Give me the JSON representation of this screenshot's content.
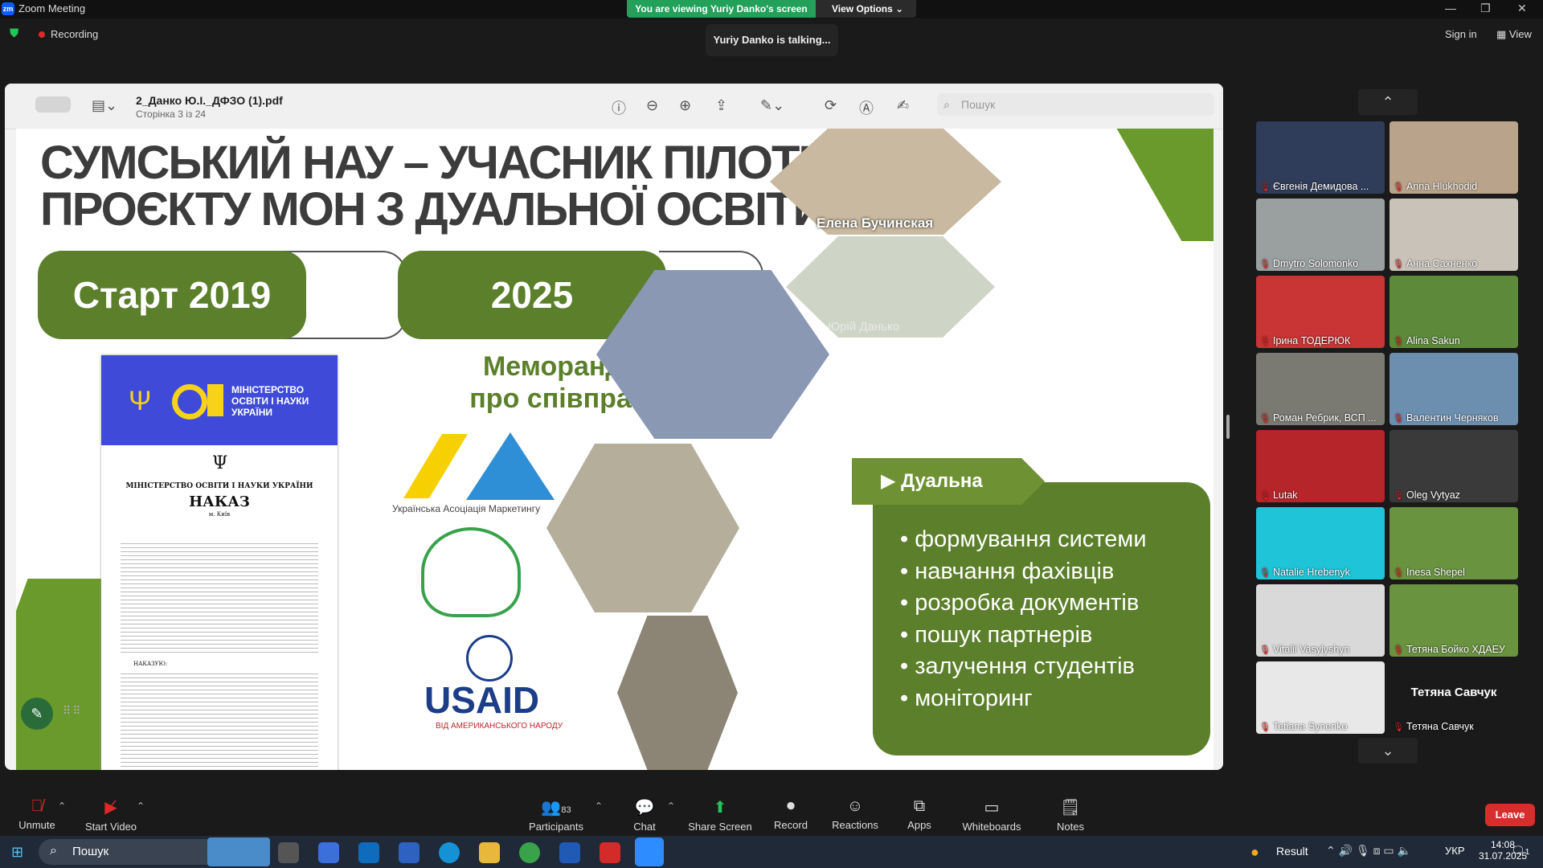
{
  "window": {
    "title": "Zoom Meeting",
    "minimize": "—",
    "maximize": "❐",
    "close": "✕"
  },
  "banner": {
    "viewing": "You are viewing Yuriy Danko's screen",
    "view_options": "View Options"
  },
  "status": {
    "recording": "Recording",
    "talking": "Yuriy Danko is talking...",
    "sign_in": "Sign in",
    "view": "View"
  },
  "pdf": {
    "filename": "2_Данко Ю.І._ДФЗО (1).pdf",
    "page_info": "Сторінка 3 із 24",
    "search_placeholder": "Пошук"
  },
  "slide": {
    "title_line1": "СУМСЬКИЙ НАУ – УЧАСНИК ПІЛОТНОГО",
    "title_line2": "ПРОЄКТУ МОН З ДУАЛЬНОЇ ОСВІТИ",
    "start": "Старт 2019",
    "year": "2025",
    "memo_line1": "Меморандум",
    "memo_line2": "про співпрацю",
    "uam": "Українська Асоціація Маркетингу",
    "usaid": "USAID",
    "usaid_sub": "ВІД АМЕРИКАНСЬКОГО НАРОДУ",
    "ministry_line1": "МІНІСТЕРСТВО",
    "ministry_line2": "ОСВІТИ І НАУКИ",
    "ministry_line3": "УКРАЇНИ",
    "doc_ministry": "МІНІСТЕРСТВО ОСВІТИ І НАУКИ УКРАЇНИ",
    "doc_title": "НАКАЗ",
    "doc_city": "м. Київ",
    "doc_order": "НАКАЗУЮ:",
    "embedded_name1": "Елена Бучинская",
    "embedded_name2": "Юрій Данько",
    "dual_heading": "Дуальна освіта",
    "bullets": [
      "формування системи",
      "навчання фахівців",
      "розробка документів",
      "пошук партнерів",
      "залучення студентів",
      "моніторинг"
    ]
  },
  "participants": [
    {
      "name": "Євгенія Демидова ...",
      "color": "#2f3d5a"
    },
    {
      "name": "Anna Hlukhodid",
      "color": "#b9a38a"
    },
    {
      "name": "Dmytro Solomonko",
      "color": "#9aa0a0"
    },
    {
      "name": "Анна Сахненко",
      "color": "#c9c2b8"
    },
    {
      "name": "Ірина ТОДЕРЮК",
      "color": "#c93434"
    },
    {
      "name": "Alina Sakun",
      "color": "#5d8a3a"
    },
    {
      "name": "Роман Ребрик, ВСП ...",
      "color": "#7a7a72"
    },
    {
      "name": "Валентин Черняков",
      "color": "#6c8fb0"
    },
    {
      "name": "Lutak",
      "color": "#b6252a"
    },
    {
      "name": "Oleg Vytyaz",
      "color": "#3a3a3a"
    },
    {
      "name": "Natalie Hrebenyk",
      "color": "#1fc4d8"
    },
    {
      "name": "Inesa Shepel",
      "color": "#6a9340"
    },
    {
      "name": "Vitalii Vasylyshyn",
      "color": "#d9d9d9"
    },
    {
      "name": "Тетяна Бойко ХДАЕУ",
      "color": "#6a9340"
    },
    {
      "name": "Tetiana Synenko",
      "color": "#e8e8e8"
    },
    {
      "name": "Тетяна Савчук",
      "color": "#1a1a1a",
      "label": "Тетяна Савчук"
    }
  ],
  "toolbar": {
    "unmute": "Unmute",
    "start_video": "Start Video",
    "participants": "Participants",
    "participants_count": "83",
    "chat": "Chat",
    "share": "Share Screen",
    "record": "Record",
    "reactions": "Reactions",
    "apps": "Apps",
    "whiteboards": "Whiteboards",
    "notes": "Notes",
    "leave": "Leave"
  },
  "taskbar": {
    "search": "Пошук",
    "result": "Result",
    "lang": "УКР",
    "time": "14:08",
    "date": "31.07.2025",
    "notif": "1"
  }
}
